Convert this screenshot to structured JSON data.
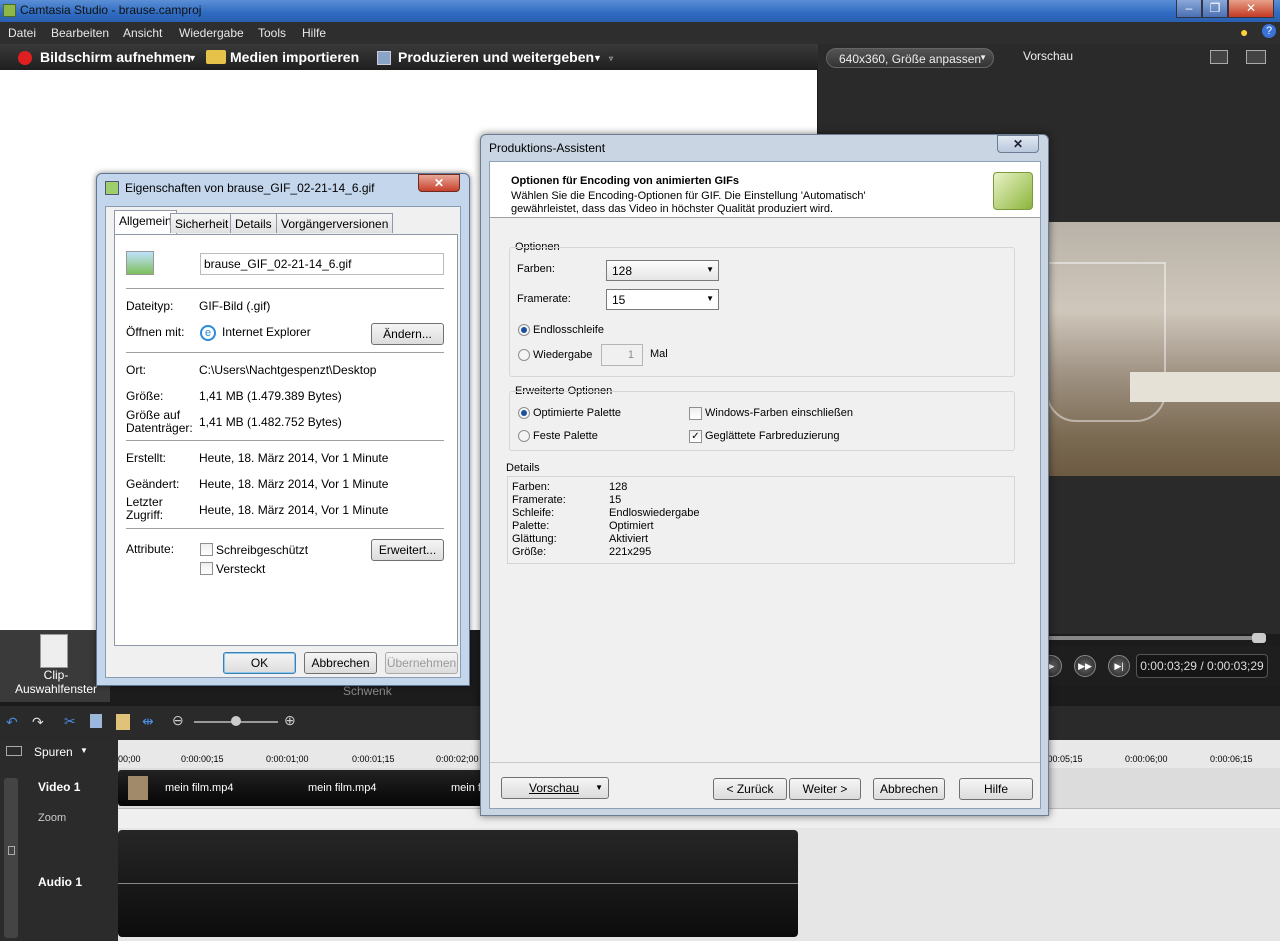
{
  "app": {
    "title": "Camtasia Studio - brause.camproj"
  },
  "menu": [
    "Datei",
    "Bearbeiten",
    "Ansicht",
    "Wiedergabe",
    "Tools",
    "Hilfe"
  ],
  "toolbar": {
    "record": "Bildschirm aufnehmen",
    "import": "Medien importieren",
    "produce": "Produzieren und weitergeben"
  },
  "preview": {
    "size_select": "640x360, Größe anpassen",
    "label": "Vorschau",
    "timecode": "0:00:03;29 / 0:00:03;29"
  },
  "clipbin": {
    "label": "Clip-\nAuswahlfenster",
    "tab2": "Schwenk"
  },
  "timeline": {
    "tracks_label": "Spuren",
    "ruler": [
      "00;00",
      "0:00:00;15",
      "0:00:01;00",
      "0:00:01;15",
      "0:00:02;00",
      "0:00:05;15",
      "0:00:06;00",
      "0:00:06;15"
    ],
    "video_track": "Video 1",
    "zoom_track": "Zoom",
    "audio_track": "Audio 1",
    "clips": [
      "mein film.mp4",
      "mein film.mp4",
      "mein fi"
    ]
  },
  "props": {
    "title": "Eigenschaften von brause_GIF_02-21-14_6.gif",
    "tabs": [
      "Allgemein",
      "Sicherheit",
      "Details",
      "Vorgängerversionen"
    ],
    "filename": "brause_GIF_02-21-14_6.gif",
    "rows": {
      "dateityp_l": "Dateityp:",
      "dateityp_v": "GIF-Bild (.gif)",
      "oeffnen_l": "Öffnen mit:",
      "oeffnen_v": "Internet Explorer",
      "aendern": "Ändern...",
      "ort_l": "Ort:",
      "ort_v": "C:\\Users\\Nachtgespenzt\\Desktop",
      "groesse_l": "Größe:",
      "groesse_v": "1,41 MB (1.479.389 Bytes)",
      "gd_l": "Größe auf\nDatenträger:",
      "gd_v": "1,41 MB (1.482.752 Bytes)",
      "erstellt_l": "Erstellt:",
      "erstellt_v": "Heute, 18. März 2014, Vor 1 Minute",
      "geaendert_l": "Geändert:",
      "geaendert_v": "Heute, 18. März 2014, Vor 1 Minute",
      "zugriff_l": "Letzter\nZugriff:",
      "zugriff_v": "Heute, 18. März 2014, Vor 1 Minute",
      "attr_l": "Attribute:",
      "schreib": "Schreibgeschützt",
      "versteckt": "Versteckt",
      "erweitert": "Erweitert..."
    },
    "buttons": {
      "ok": "OK",
      "cancel": "Abbrechen",
      "apply": "Übernehmen"
    }
  },
  "wizard": {
    "title": "Produktions-Assistent",
    "heading": "Optionen für Encoding von animierten GIFs",
    "desc1": "Wählen Sie die Encoding-Optionen für GIF. Die Einstellung 'Automatisch'",
    "desc2": "gewährleistet, dass das Video in höchster Qualität produziert wird.",
    "optionen": "Optionen",
    "farben_l": "Farben:",
    "farben_v": "128",
    "framerate_l": "Framerate:",
    "framerate_v": "15",
    "endlos": "Endlosschleife",
    "wiedergabe": "Wiedergabe",
    "wiedergabe_n": "1",
    "mal": "Mal",
    "erweitert": "Erweiterte Optionen",
    "opt_pal": "Optimierte Palette",
    "feste_pal": "Feste Palette",
    "win_farben": "Windows-Farben einschließen",
    "geglaettet": "Geglättete Farbreduzierung",
    "details": "Details",
    "detail_rows": [
      [
        "Farben:",
        "128"
      ],
      [
        "Framerate:",
        "15"
      ],
      [
        "Schleife:",
        "Endloswiedergabe"
      ],
      [
        "Palette:",
        "Optimiert"
      ],
      [
        "Glättung:",
        "Aktiviert"
      ],
      [
        "Größe:",
        "221x295"
      ]
    ],
    "buttons": {
      "vorschau": "Vorschau",
      "zurueck": "< Zurück",
      "weiter": "Weiter >",
      "abbrechen": "Abbrechen",
      "hilfe": "Hilfe"
    }
  }
}
